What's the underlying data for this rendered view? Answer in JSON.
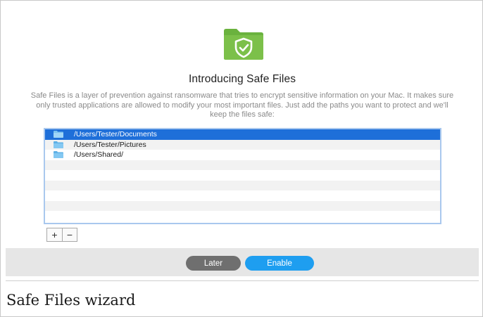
{
  "dialog": {
    "icon": "shield-folder-icon",
    "title": "Introducing Safe Files",
    "description": "Safe Files is a layer of prevention against ransomware that tries to encrypt sensitive information on your Mac. It makes sure only trusted applications are allowed to modify your most important files. Just add the paths you want to protect and we'll keep the files safe:",
    "paths": [
      {
        "path": "/Users/Tester/Documents",
        "icon": "folder-icon",
        "selected": true
      },
      {
        "path": "/Users/Tester/Pictures",
        "icon": "folder-icon",
        "selected": false
      },
      {
        "path": "/Users/Shared/",
        "icon": "folder-icon",
        "selected": false
      }
    ],
    "add_label": "+",
    "remove_label": "−",
    "later_label": "Later",
    "enable_label": "Enable"
  },
  "caption": "Safe Files wizard",
  "colors": {
    "brand_green": "#6ab23e",
    "selection_blue": "#1e6fd9",
    "enable_blue": "#1e9ef0",
    "later_gray": "#6f6f6f"
  }
}
